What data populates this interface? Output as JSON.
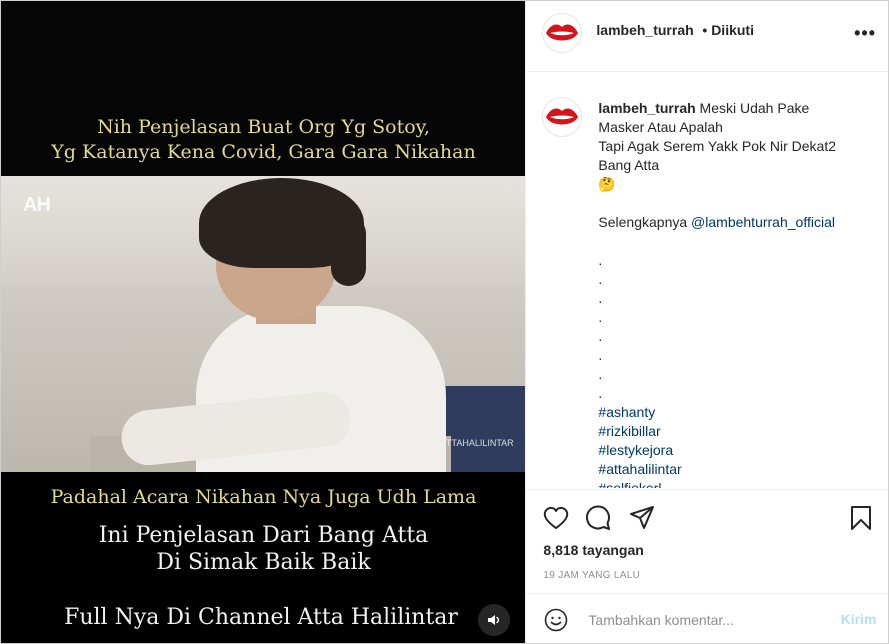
{
  "header": {
    "username": "lambeh_turrah",
    "follow_status": "• Diikuti",
    "more_icon": "more-dots-icon"
  },
  "video": {
    "caption_top_line1": "Nih Penjelasan Buat Org Yg Sotoy,",
    "caption_top_line2": "Yg Katanya Kena Covid, Gara Gara Nikahan",
    "logo": "AH",
    "watermark": "TTAHALILINTAR",
    "caption_mid": "Padahal Acara Nikahan Nya Juga Udh Lama",
    "caption_white1": "Ini Penjelasan Dari Bang Atta",
    "caption_white2": "Di Simak Baik Baik",
    "caption_bottom": "Full Nya Di Channel Atta Halilintar",
    "volume_icon": "speaker-icon"
  },
  "post": {
    "username": "lambeh_turrah",
    "caption_line1": "Meski Udah Pake",
    "caption_line2": "Masker Atau Apalah",
    "caption_line3": "Tapi Agak Serem Yakk Pok Nir Dekat2",
    "caption_line4": "Bang Atta",
    "emoji": "🤔",
    "more_prefix": "Selengkapnya ",
    "mention": "@lambehturrah_official",
    "dots": [
      ".",
      ".",
      ".",
      ".",
      ".",
      ".",
      ".",
      "."
    ],
    "hashtags": [
      "#ashanty",
      "#rizkibillar",
      "#lestykejora",
      "#attahalilintar",
      "#selfiekerl"
    ]
  },
  "actions": {
    "like_icon": "heart-icon",
    "comment_icon": "comment-bubble-icon",
    "share_icon": "send-plane-icon",
    "save_icon": "bookmark-icon",
    "views": "8,818 tayangan",
    "time": "19 JAM YANG LALU"
  },
  "comment": {
    "placeholder": "Tambahkan komentar...",
    "send_label": "Kirim",
    "emoji_icon": "smiley-icon"
  },
  "colors": {
    "link": "#00376b",
    "caption_yellow": "#e4db8a",
    "send_disabled": "#b2dffc"
  }
}
